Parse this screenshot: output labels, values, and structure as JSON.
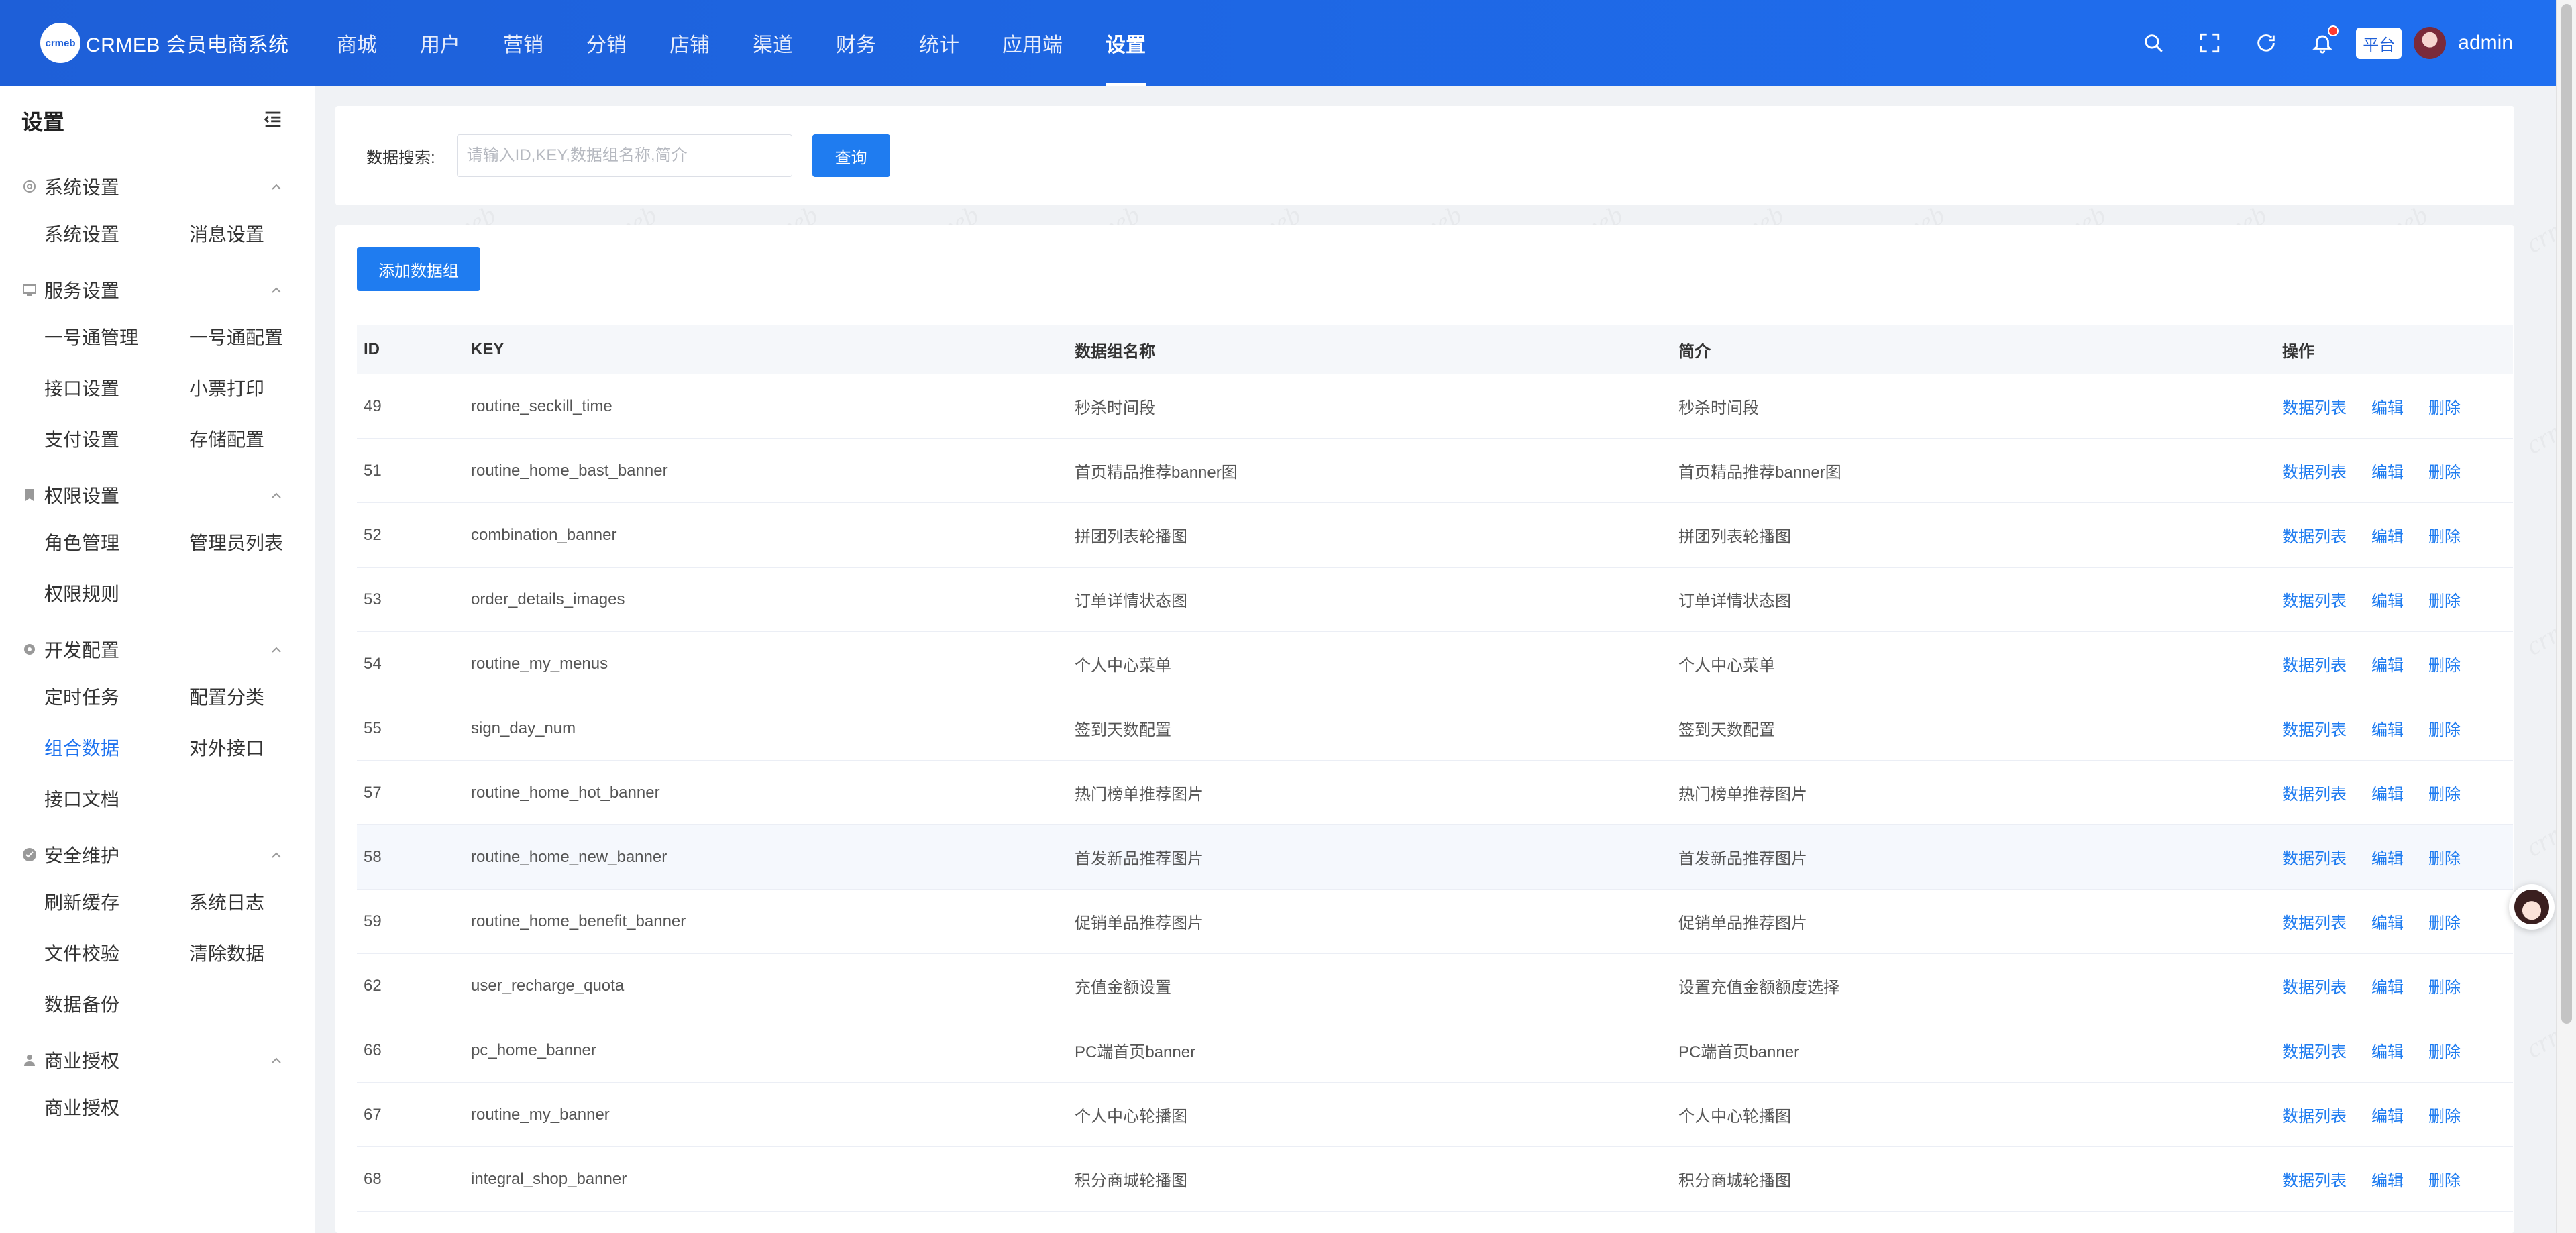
{
  "header": {
    "logo_mark": "crmeb",
    "logo_text": "CRMEB 会员电商系统",
    "nav": [
      "商城",
      "用户",
      "营销",
      "分销",
      "店铺",
      "渠道",
      "财务",
      "统计",
      "应用端",
      "设置"
    ],
    "active_nav": "设置",
    "platform_badge": "平台",
    "username": "admin"
  },
  "sidebar": {
    "title": "设置",
    "groups": [
      {
        "label": "系统设置",
        "icon": "gear-icon",
        "items": [
          "系统设置",
          "消息设置"
        ]
      },
      {
        "label": "服务设置",
        "icon": "monitor-icon",
        "items": [
          "一号通管理",
          "一号通配置",
          "接口设置",
          "小票打印",
          "支付设置",
          "存储配置"
        ]
      },
      {
        "label": "权限设置",
        "icon": "bookmark-icon",
        "items": [
          "角色管理",
          "管理员列表",
          "权限规则"
        ]
      },
      {
        "label": "开发配置",
        "icon": "cog-icon",
        "items": [
          "定时任务",
          "配置分类",
          "组合数据",
          "对外接口",
          "接口文档"
        ]
      },
      {
        "label": "安全维护",
        "icon": "shield-check-icon",
        "items": [
          "刷新缓存",
          "系统日志",
          "文件校验",
          "清除数据",
          "数据备份"
        ]
      },
      {
        "label": "商业授权",
        "icon": "user-icon",
        "items": [
          "商业授权"
        ]
      }
    ],
    "active_item": "组合数据"
  },
  "search": {
    "label": "数据搜索:",
    "placeholder": "请输入ID,KEY,数据组名称,简介",
    "value": "",
    "button": "查询"
  },
  "toolbar": {
    "add_label": "添加数据组"
  },
  "table": {
    "headers": [
      "ID",
      "KEY",
      "数据组名称",
      "简介",
      "操作"
    ],
    "actions": [
      "数据列表",
      "编辑",
      "删除"
    ],
    "rows": [
      {
        "id": "49",
        "key": "routine_seckill_time",
        "name": "秒杀时间段",
        "desc": "秒杀时间段"
      },
      {
        "id": "51",
        "key": "routine_home_bast_banner",
        "name": "首页精品推荐banner图",
        "desc": "首页精品推荐banner图"
      },
      {
        "id": "52",
        "key": "combination_banner",
        "name": "拼团列表轮播图",
        "desc": "拼团列表轮播图"
      },
      {
        "id": "53",
        "key": "order_details_images",
        "name": "订单详情状态图",
        "desc": "订单详情状态图"
      },
      {
        "id": "54",
        "key": "routine_my_menus",
        "name": "个人中心菜单",
        "desc": "个人中心菜单"
      },
      {
        "id": "55",
        "key": "sign_day_num",
        "name": "签到天数配置",
        "desc": "签到天数配置"
      },
      {
        "id": "57",
        "key": "routine_home_hot_banner",
        "name": "热门榜单推荐图片",
        "desc": "热门榜单推荐图片"
      },
      {
        "id": "58",
        "key": "routine_home_new_banner",
        "name": "首发新品推荐图片",
        "desc": "首发新品推荐图片"
      },
      {
        "id": "59",
        "key": "routine_home_benefit_banner",
        "name": "促销单品推荐图片",
        "desc": "促销单品推荐图片"
      },
      {
        "id": "62",
        "key": "user_recharge_quota",
        "name": "充值金额设置",
        "desc": "设置充值金额额度选择"
      },
      {
        "id": "66",
        "key": "pc_home_banner",
        "name": "PC端首页banner",
        "desc": "PC端首页banner"
      },
      {
        "id": "67",
        "key": "routine_my_banner",
        "name": "个人中心轮播图",
        "desc": "个人中心轮播图"
      },
      {
        "id": "68",
        "key": "integral_shop_banner",
        "name": "积分商城轮播图",
        "desc": "积分商城轮播图"
      }
    ],
    "hover_row_id": "58"
  },
  "colors": {
    "header_bg": "#1e5fd8",
    "primary": "#1f7cf0",
    "page_bg": "#f0f2f5",
    "table_head_bg": "#f5f7fa"
  }
}
